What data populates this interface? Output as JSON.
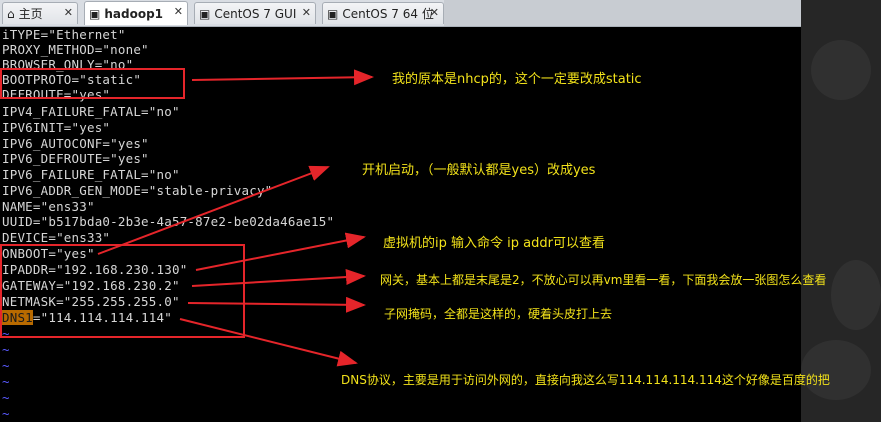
{
  "tabs": [
    {
      "label": "主页",
      "icon": "home-icon",
      "active": false
    },
    {
      "label": "hadoop1",
      "icon": "vm-icon",
      "active": true
    },
    {
      "label": "CentOS 7 GUI",
      "icon": "vm-icon",
      "active": false
    },
    {
      "label": "CentOS 7 64 位",
      "icon": "vm-icon",
      "active": false
    }
  ],
  "terminal": {
    "lines": [
      "iTYPE=\"Ethernet\"",
      "PROXY_METHOD=\"none\"",
      "BROWSER_ONLY=\"no\"",
      "BOOTPROTO=\"static\"",
      "DEFROUTE=\"yes\"",
      "IPV4_FAILURE_FATAL=\"no\"",
      "IPV6INIT=\"yes\"",
      "IPV6_AUTOCONF=\"yes\"",
      "IPV6_DEFROUTE=\"yes\"",
      "IPV6_FAILURE_FATAL=\"no\"",
      "IPV6_ADDR_GEN_MODE=\"stable-privacy\"",
      "NAME=\"ens33\"",
      "UUID=\"b517bda0-2b3e-4a57-87e2-be02da46ae15\"",
      "DEVICE=\"ens33\"",
      "ONBOOT=\"yes\"",
      "IPADDR=\"192.168.230.130\"",
      "GATEWAY=\"192.168.230.2\"",
      "NETMASK=\"255.255.255.0\""
    ],
    "dns_key": "DNS1",
    "dns_value": "=\"114.114.114.114\"",
    "tilde": "~"
  },
  "annotations": {
    "bootproto": "我的原本是nhcp的，这个一定要改成static",
    "onboot": "开机启动，（一般默认都是yes）改成yes",
    "ipaddr": "虚拟机的ip   输入命令 ip addr可以查看",
    "gateway": "网关，基本上都是末尾是2，不放心可以再vm里看一看，下面我会放一张图怎么查看",
    "netmask": "子网掩码，全都是这样的，硬着头皮打上去",
    "dns": "DNS协议，主要是用于访问外网的，直接向我这么写114.114.114.114这个好像是百度的把"
  },
  "colors": {
    "annotation_text": "#f2e21a",
    "box_and_arrow": "#e5252a",
    "terminal_bg": "#000000",
    "terminal_text": "#d6d6d6"
  }
}
